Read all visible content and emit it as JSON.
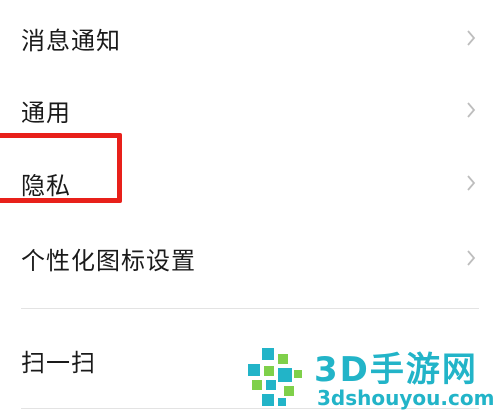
{
  "settings": {
    "items": [
      {
        "label": "消息通知"
      },
      {
        "label": "通用"
      },
      {
        "label": "隐私"
      },
      {
        "label": "个性化图标设置"
      },
      {
        "label": "扫一扫"
      }
    ]
  },
  "icons": {
    "chevron": "chevron-right-icon"
  },
  "colors": {
    "highlight_border": "#e8201a",
    "watermark": "#22b4c8",
    "chevron": "#bdbdbd",
    "text": "#1a1a1a"
  },
  "watermark": {
    "title": "3D手游网",
    "url": "3dshouyou.com"
  }
}
